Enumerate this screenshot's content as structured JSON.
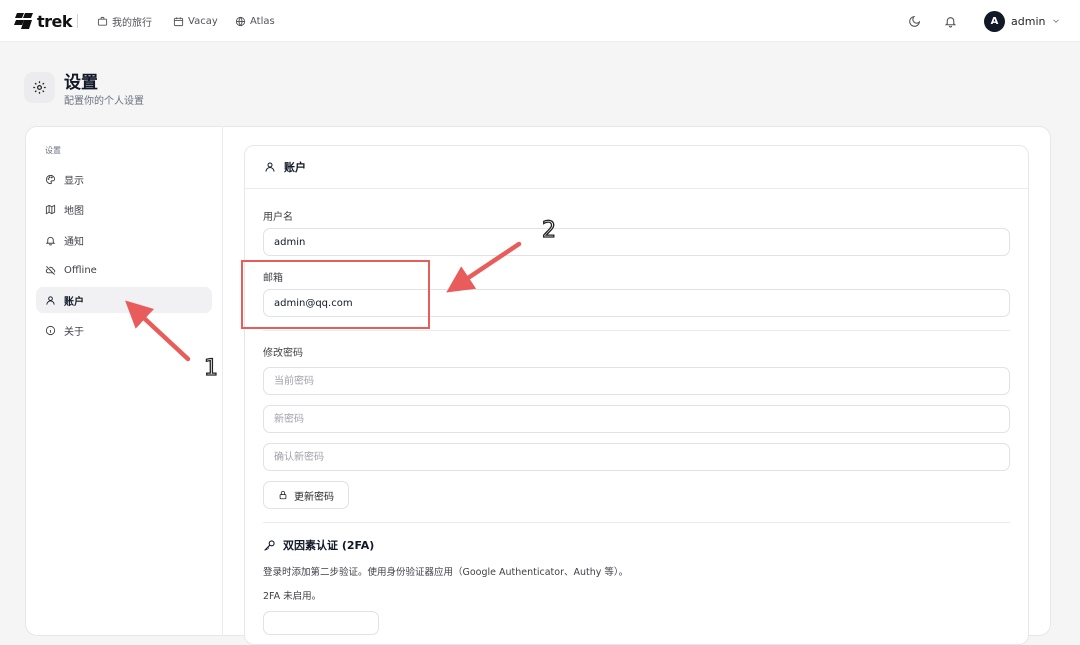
{
  "brand": {
    "name": "trek"
  },
  "nav": {
    "links": [
      {
        "label": "我的旅行",
        "icon": "briefcase-icon"
      },
      {
        "label": "Vacay",
        "icon": "calendar-icon"
      },
      {
        "label": "Atlas",
        "icon": "globe-icon"
      }
    ],
    "theme_icon": "moon-icon",
    "notifications_icon": "bell-icon",
    "user": {
      "initial": "A",
      "name": "admin"
    }
  },
  "page": {
    "icon": "gear-icon",
    "title": "设置",
    "subtitle": "配置你的个人设置"
  },
  "sidebar": {
    "heading": "设置",
    "items": [
      {
        "label": "显示",
        "icon": "palette-icon",
        "active": false
      },
      {
        "label": "地图",
        "icon": "map-icon",
        "active": false
      },
      {
        "label": "通知",
        "icon": "bell-icon",
        "active": false
      },
      {
        "label": "Offline",
        "icon": "cloud-off-icon",
        "active": false
      },
      {
        "label": "账户",
        "icon": "user-icon",
        "active": true
      },
      {
        "label": "关于",
        "icon": "info-icon",
        "active": false
      }
    ]
  },
  "account": {
    "title": "账户",
    "username_label": "用户名",
    "username_value": "admin",
    "email_label": "邮箱",
    "email_value": "admin@qq.com",
    "password_label": "修改密码",
    "current_password_placeholder": "当前密码",
    "new_password_placeholder": "新密码",
    "confirm_password_placeholder": "确认新密码",
    "update_button": "更新密码"
  },
  "two_factor": {
    "title": "双因素认证 (2FA)",
    "description": "登录时添加第二步验证。使用身份验证器应用（Google Authenticator、Authy 等）。",
    "status": "2FA 未启用。"
  },
  "annotations": {
    "color": "#e85c5c",
    "labels": [
      "1",
      "2"
    ]
  }
}
